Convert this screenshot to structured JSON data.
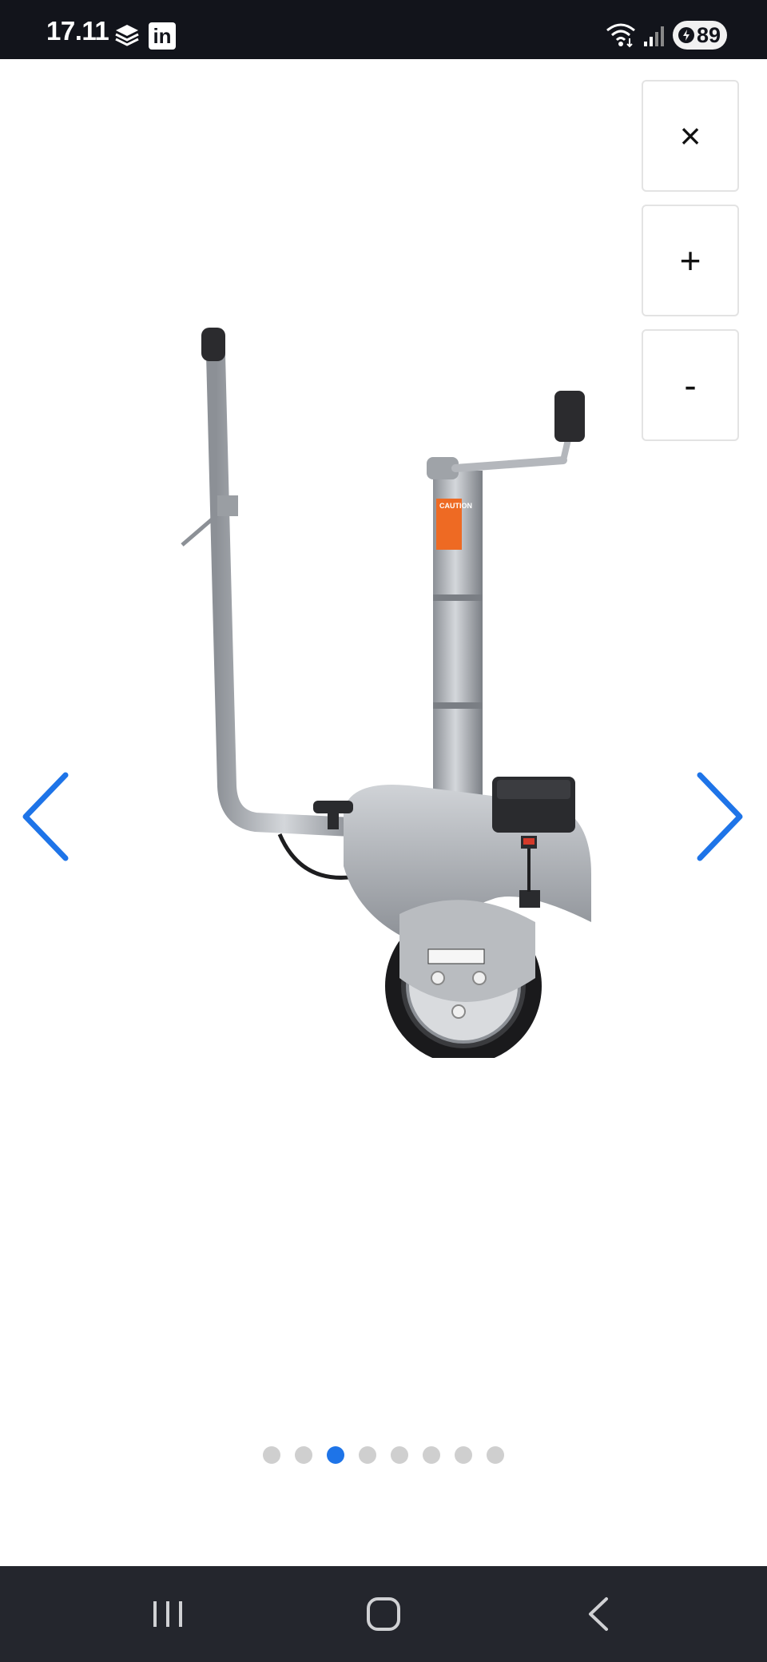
{
  "status_bar": {
    "time": "17.11",
    "battery_level": "89",
    "app_icons": [
      "box-icon",
      "linkedin-icon"
    ],
    "linkedin_label": "in"
  },
  "viewer": {
    "close_label": "×",
    "zoom_in_label": "+",
    "zoom_out_label": "-",
    "prev_icon": "chevron-left-icon",
    "next_icon": "chevron-right-icon",
    "image_subject": "electric jockey wheel",
    "image_label_warning": "CAUTION",
    "pagination": {
      "total": 8,
      "active_index": 2
    },
    "accent_color": "#1e74e8"
  },
  "nav_bar": {
    "icons": [
      "recents-icon",
      "home-icon",
      "back-icon"
    ]
  }
}
